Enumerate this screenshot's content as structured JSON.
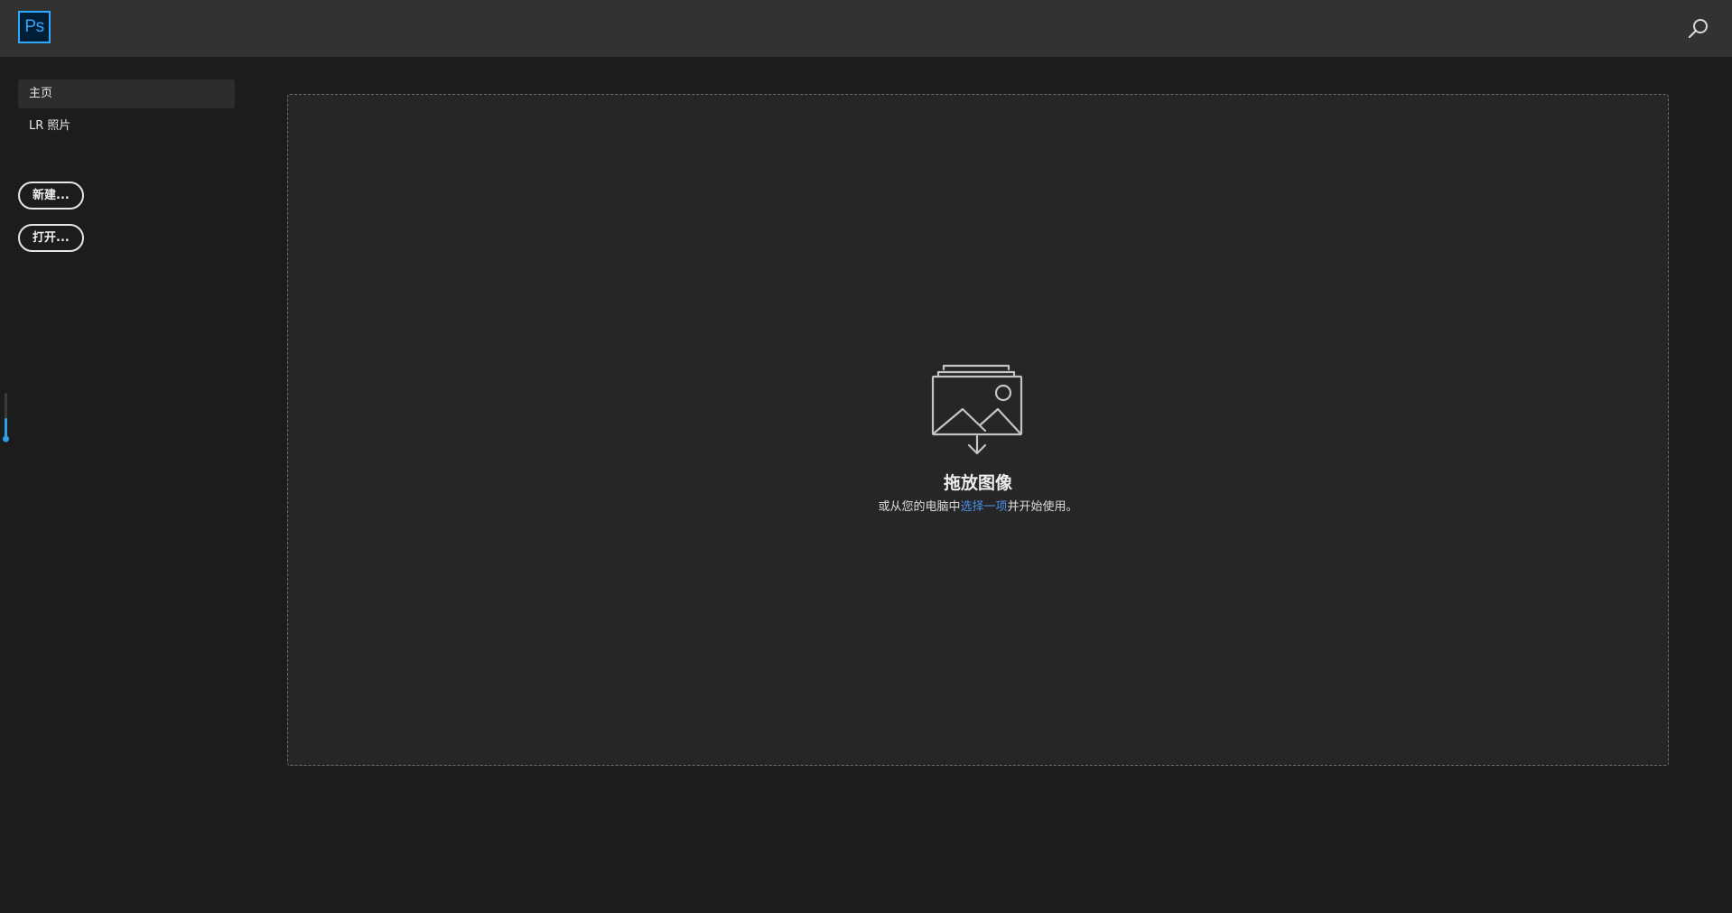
{
  "app": {
    "logo_text": "Ps",
    "brand_color": "#31a8ff"
  },
  "header": {
    "search_icon": "search-icon"
  },
  "sidebar": {
    "items": [
      {
        "label": "主页",
        "active": true
      },
      {
        "label": "LR 照片",
        "active": false
      }
    ],
    "buttons": {
      "new_label": "新建...",
      "open_label": "打开..."
    }
  },
  "dropzone": {
    "icon": "image-drop-icon",
    "title": "拖放图像",
    "subtitle_prefix": "或从您的电脑中",
    "subtitle_link": "选择一项",
    "subtitle_suffix": "并开始使用。",
    "link_color": "#4a90e8"
  }
}
